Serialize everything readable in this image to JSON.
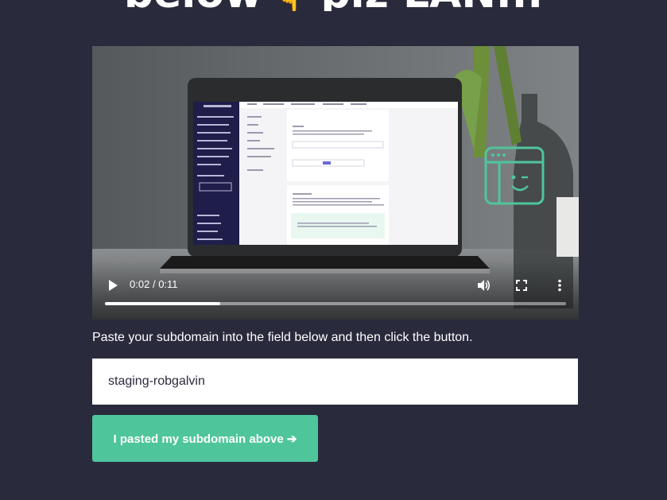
{
  "heading": {
    "text_left": "below",
    "emoji": "👇",
    "text_right": "plz LAN..."
  },
  "video": {
    "current_time": "0:02",
    "separator": "/",
    "duration": "0:11",
    "progress": 0.25,
    "controls": {
      "play_icon": "play-icon",
      "volume_icon": "volume-icon",
      "fullscreen_icon": "fullscreen-icon",
      "more_icon": "more-options-icon"
    },
    "screen_app": {
      "brand": "THINKIFIC",
      "nav_items": [
        "MANAGE LEARNING CONTENT",
        "SELL YOUR SITE",
        "MARKET & SELL",
        "SUPPORT YOUR STUDENTS",
        "ADVANCED REPORTING",
        "SETTINGS",
        "APPS",
        "YOUR ACCOUNT"
      ],
      "tabs": [
        "Site",
        "Learning Content",
        "Courses & Community",
        "Email & Notifications",
        "Advanced"
      ],
      "panel_titles": [
        "Site URL",
        "SSL Certificate"
      ]
    }
  },
  "form": {
    "instruction": "Paste your subdomain into the field below and then click the button.",
    "input_value": "staging-robgalvin",
    "submit_label": "I pasted my subdomain above ➔"
  },
  "colors": {
    "background": "#2a2a3d",
    "accent": "#4fc59c",
    "input_bg": "#ffffff"
  }
}
